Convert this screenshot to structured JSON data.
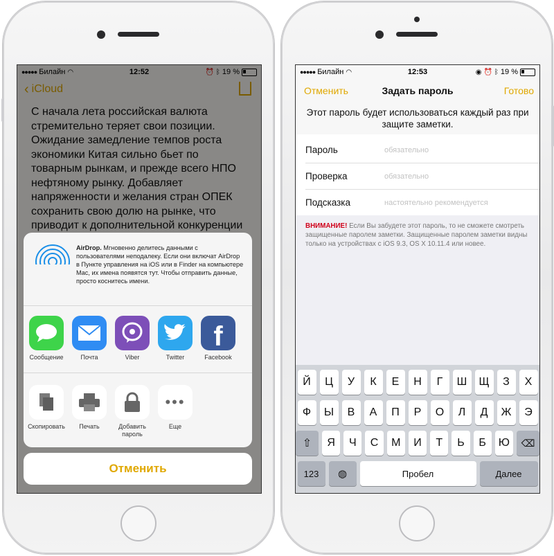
{
  "status_left": {
    "carrier": "Билайн",
    "time": "12:52",
    "battery": "19 %"
  },
  "status_right": {
    "carrier": "Билайн",
    "time": "12:53",
    "battery": "19 %"
  },
  "notes": {
    "back_label": "iCloud",
    "body": "С начала лета российская валюта стремительно теряет свои позиции. Ожидание замедление темпов роста экономики Китая сильно бьет по товарным рынкам, и прежде всего НПО нефтяному рынку. Добавляет напряженности и желания стран ОПЕК сохранить свою долю на рынке, что приводит к дополнительной конкуренции и снижению цен на нефть."
  },
  "share": {
    "airdrop_title": "AirDrop.",
    "airdrop_text": " Мгновенно делитесь данными с пользователями неподалеку. Если они включат AirDrop в Пункте управления на iOS или в Finder на компьютере Mac, их имена появятся тут. Чтобы отправить данные, просто коснитесь имени.",
    "apps": [
      {
        "label": "Сообщение",
        "icon": "messages-icon"
      },
      {
        "label": "Почта",
        "icon": "mail-icon"
      },
      {
        "label": "Viber",
        "icon": "viber-icon"
      },
      {
        "label": "Twitter",
        "icon": "twitter-icon"
      },
      {
        "label": "Facebook",
        "icon": "facebook-icon"
      }
    ],
    "actions": [
      {
        "label": "Скопировать",
        "icon": "copy-icon"
      },
      {
        "label": "Печать",
        "icon": "print-icon"
      },
      {
        "label": "Добавить\nпароль",
        "icon": "lock-icon"
      },
      {
        "label": "Еще",
        "icon": "more-icon"
      }
    ],
    "cancel_label": "Отменить"
  },
  "password": {
    "nav_cancel": "Отменить",
    "nav_title": "Задать пароль",
    "nav_done": "Готово",
    "description": "Этот пароль будет использоваться каждый раз при защите заметки.",
    "fields": [
      {
        "label": "Пароль",
        "placeholder": "обязательно"
      },
      {
        "label": "Проверка",
        "placeholder": "обязательно"
      },
      {
        "label": "Подсказка",
        "placeholder": "настоятельно рекомендуется"
      }
    ],
    "warning_title": "ВНИМАНИЕ!",
    "warning_text": " Если Вы забудете этот пароль, то не сможете смотреть защищенные паролем заметки. Защищенные паролем заметки видны только на устройствах с iOS 9.3, OS X 10.11.4 или новее."
  },
  "keyboard": {
    "row1": [
      "Й",
      "Ц",
      "У",
      "К",
      "Е",
      "Н",
      "Г",
      "Ш",
      "Щ",
      "З",
      "Х"
    ],
    "row2": [
      "Ф",
      "Ы",
      "В",
      "А",
      "П",
      "Р",
      "О",
      "Л",
      "Д",
      "Ж",
      "Э"
    ],
    "row3": [
      "Я",
      "Ч",
      "С",
      "М",
      "И",
      "Т",
      "Ь",
      "Б",
      "Ю"
    ],
    "numbers_label": "123",
    "space_label": "Пробел",
    "return_label": "Далее"
  },
  "colors": {
    "accent": "#e0a800",
    "warning": "#d0021b"
  }
}
